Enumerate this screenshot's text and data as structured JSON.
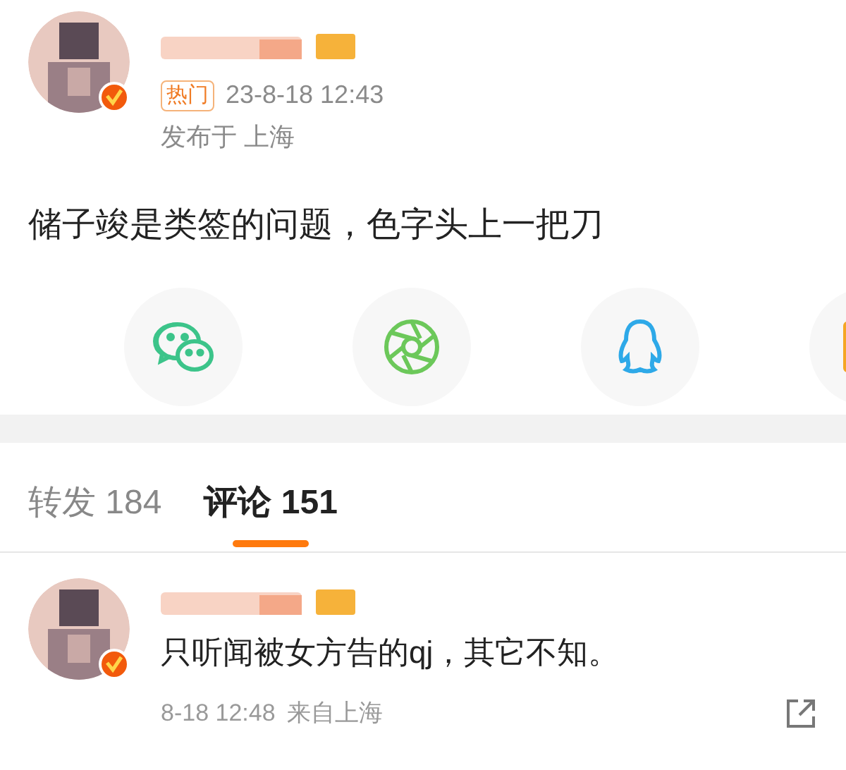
{
  "post": {
    "verified": true,
    "hot_tag": "热门",
    "time": "23-8-18 12:43",
    "location": "发布于 上海",
    "text": "储子竣是类签的问题，色字头上一把刀"
  },
  "share_targets": [
    {
      "kind": "chat",
      "color": "#3cc48a"
    },
    {
      "kind": "aperture",
      "color": "#6cc85a"
    },
    {
      "kind": "penguin",
      "color": "#2ea9e8"
    },
    {
      "kind": "partial",
      "color": "#f5a623"
    }
  ],
  "tabs": [
    {
      "label": "转发",
      "count": "184",
      "selected": false
    },
    {
      "label": "评论",
      "count": "151",
      "selected": true
    }
  ],
  "comments": [
    {
      "verified": true,
      "text": "只听闻被女方告的qj，其它不知。",
      "time": "8-18 12:48",
      "source": "来自上海"
    }
  ]
}
